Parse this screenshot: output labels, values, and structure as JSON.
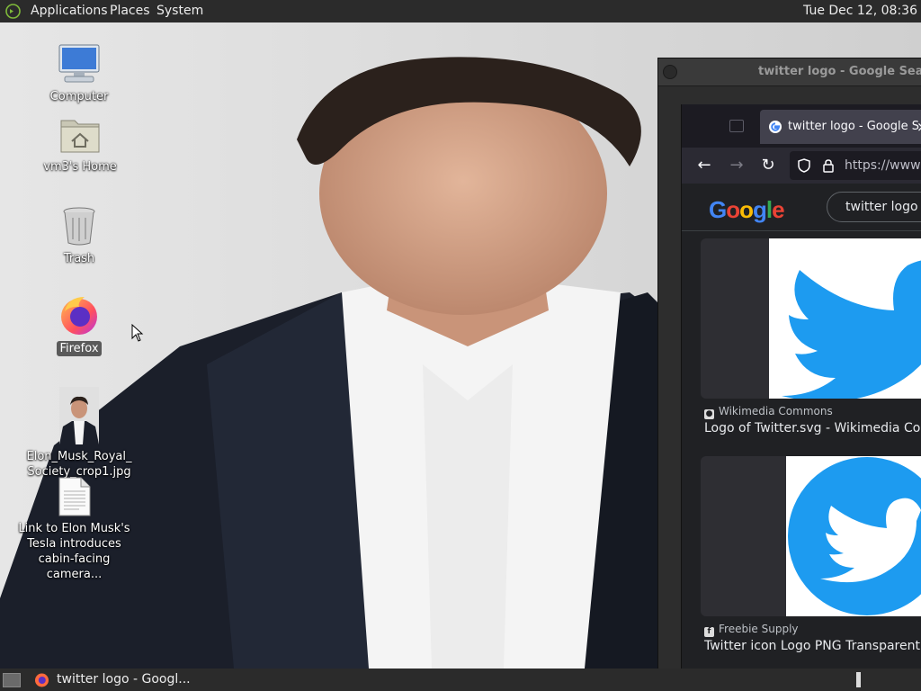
{
  "top_panel": {
    "menus": [
      "Applications",
      "Places",
      "System"
    ],
    "clock": "Tue Dec 12, 08:36"
  },
  "desktop_icons": [
    {
      "name": "computer",
      "label": "Computer",
      "icon": "monitor-icon"
    },
    {
      "name": "home",
      "label": "vm3's Home",
      "icon": "home-folder-icon"
    },
    {
      "name": "trash",
      "label": "Trash",
      "icon": "trash-icon"
    },
    {
      "name": "firefox",
      "label": "Firefox",
      "icon": "firefox-icon",
      "selected": true
    },
    {
      "name": "elon-photo",
      "label": "Elon_Musk_Royal_Society_crop1.jpg",
      "label_lines": [
        "Elon_Musk_Royal_",
        "Society_crop1.jpg"
      ],
      "icon": "image-thumbnail-icon"
    },
    {
      "name": "link-file",
      "label_lines": [
        "Link to Elon Musk's",
        "Tesla introduces",
        "cabin-facing camera..."
      ],
      "icon": "text-document-icon"
    }
  ],
  "back_window": {
    "title": "twitter logo - Google Search -"
  },
  "firefox": {
    "tab_title": "twitter logo - Google S",
    "tab_close": "×",
    "url": "https://www",
    "google_logo": "Google",
    "search_query": "twitter logo",
    "results": [
      {
        "source": "Wikimedia Commons",
        "title": "Logo of Twitter.svg - Wikimedia Commo"
      },
      {
        "source": "Freebie Supply",
        "title": "Twitter icon Logo PNG Transparent & S"
      }
    ]
  },
  "taskbar": {
    "window_title": "twitter logo - Googl..."
  },
  "colors": {
    "panel": "#2b2b2b",
    "firefox_dark": "#1c1b22",
    "google_dark": "#202124",
    "twitter_blue": "#1d9bf0"
  }
}
